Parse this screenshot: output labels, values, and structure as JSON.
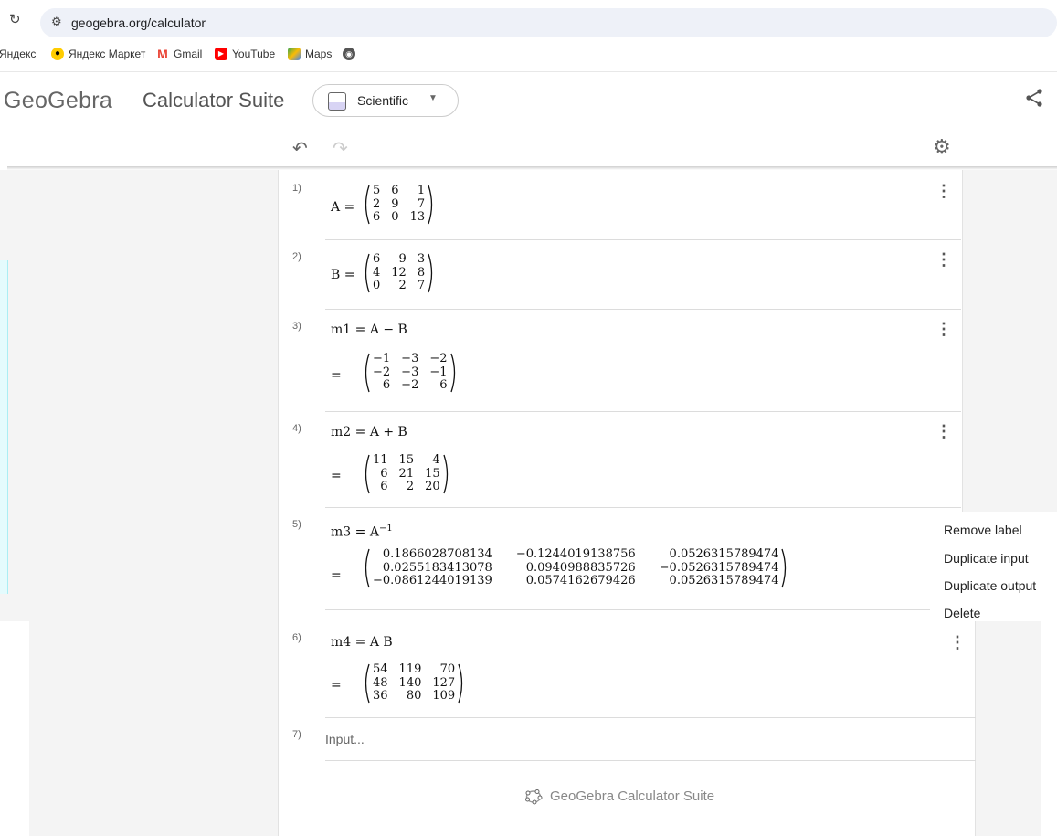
{
  "browser": {
    "url": "geogebra.org/calculator",
    "bookmarks": [
      {
        "label": "Яндекс",
        "icon": "yandex-icon"
      },
      {
        "label": "Яндекс Маркет",
        "icon": "yandex-market-icon"
      },
      {
        "label": "Gmail",
        "icon": "gmail-icon"
      },
      {
        "label": "YouTube",
        "icon": "youtube-icon"
      },
      {
        "label": "Maps",
        "icon": "maps-icon"
      },
      {
        "label": "",
        "icon": "globe-icon"
      }
    ]
  },
  "header": {
    "logo": "GeoGebra",
    "suite": "Calculator Suite",
    "app_selector": "Scientific"
  },
  "rows": [
    {
      "num": "1)",
      "lhs": "A =",
      "matrix": [
        [
          "5",
          "6",
          "1"
        ],
        [
          "2",
          "9",
          "7"
        ],
        [
          "6",
          "0",
          "13"
        ]
      ]
    },
    {
      "num": "2)",
      "lhs": "B =",
      "matrix": [
        [
          "6",
          "9",
          "3"
        ],
        [
          "4",
          "12",
          "8"
        ],
        [
          "0",
          "2",
          "7"
        ]
      ]
    },
    {
      "num": "3)",
      "expr": "m1 = A − B",
      "eq": "=",
      "matrix": [
        [
          "−1",
          "−3",
          "−2"
        ],
        [
          "−2",
          "−3",
          "−1"
        ],
        [
          "6",
          "−2",
          "6"
        ]
      ]
    },
    {
      "num": "4)",
      "expr": "m2 = A + B",
      "eq": "=",
      "matrix": [
        [
          "11",
          "15",
          "4"
        ],
        [
          "6",
          "21",
          "15"
        ],
        [
          "6",
          "2",
          "20"
        ]
      ]
    },
    {
      "num": "5)",
      "expr_base": "m3 = A",
      "expr_sup": "−1",
      "eq": "=",
      "matrix": [
        [
          "0.1866028708134",
          "−0.1244019138756",
          "0.0526315789474"
        ],
        [
          "0.0255183413078",
          "0.0940988835726",
          "−0.0526315789474"
        ],
        [
          "−0.0861244019139",
          "0.0574162679426",
          "0.0526315789474"
        ]
      ]
    },
    {
      "num": "6)",
      "expr": "m4 = A B",
      "eq": "=",
      "matrix": [
        [
          "54",
          "119",
          "70"
        ],
        [
          "48",
          "140",
          "127"
        ],
        [
          "36",
          "80",
          "109"
        ]
      ]
    },
    {
      "num": "7)",
      "placeholder": "Input..."
    }
  ],
  "context_menu": [
    "Remove label",
    "Duplicate input",
    "Duplicate output",
    "Delete"
  ],
  "footer": "GeoGebra Calculator Suite"
}
